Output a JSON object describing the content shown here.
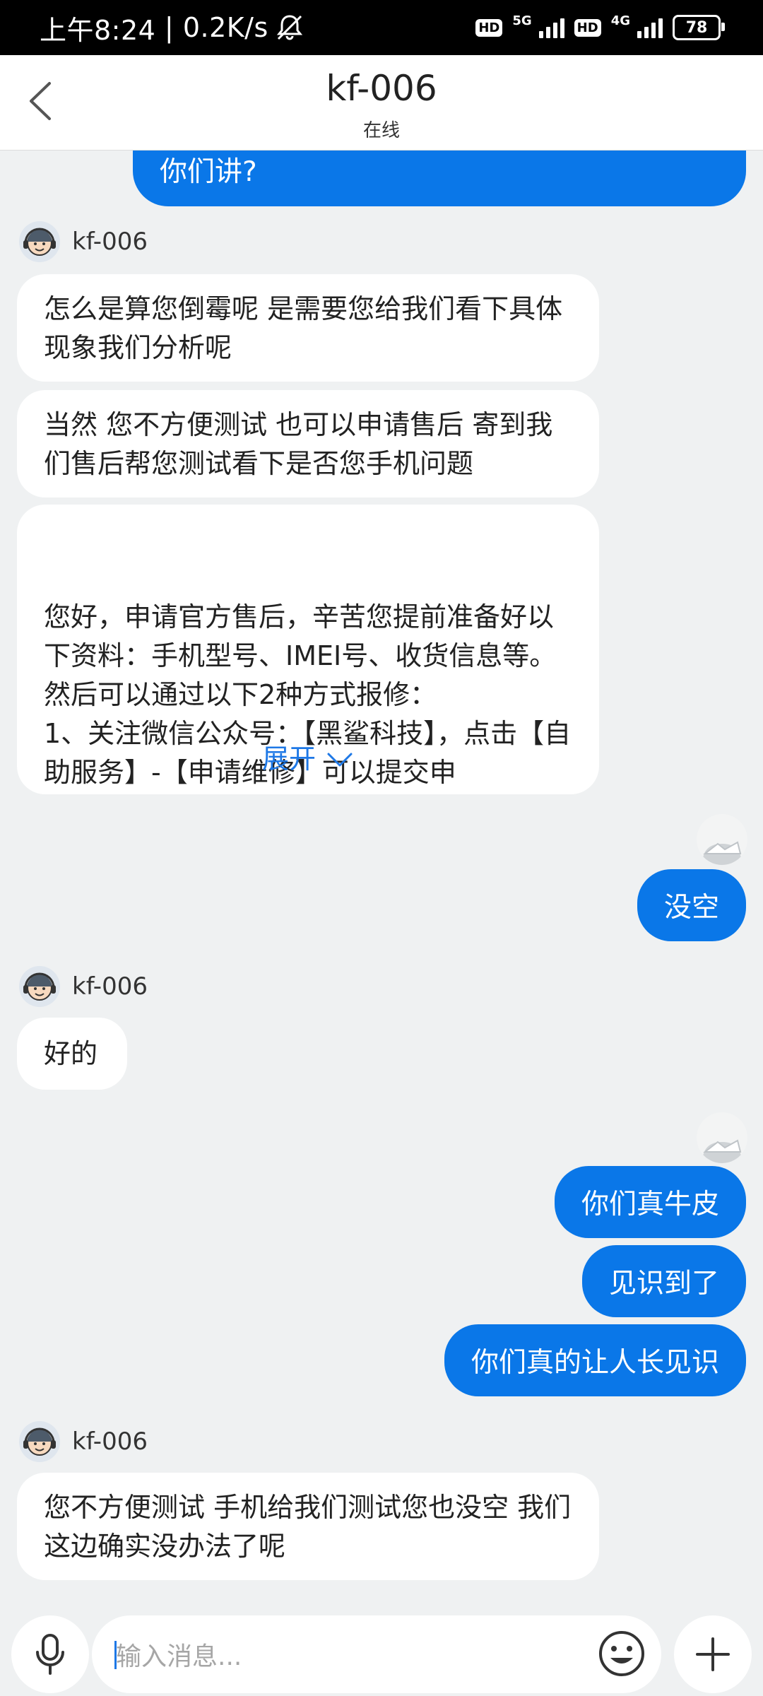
{
  "status_bar": {
    "time": "上午8:24",
    "net_speed": "0.2K/s",
    "hd1": "HD",
    "net1": "5G",
    "hd2": "HD",
    "net2": "4G",
    "battery": "78"
  },
  "header": {
    "title": "kf-006",
    "subtitle": "在线"
  },
  "messages": [
    {
      "from": "user",
      "text": "你们讲?"
    },
    {
      "from": "agent",
      "name": "kf-006",
      "text": "怎么是算您倒霉呢 是需要您给我们看下具体现象我们分析呢"
    },
    {
      "from": "agent",
      "text": "当然 您不方便测试 也可以申请售后 寄到我们售后帮您测试看下是否您手机问题"
    },
    {
      "from": "agent",
      "text": "您好，申请官方售后，辛苦您提前准备好以下资料：手机型号、IMEI号、收货信息等。然后可以通过以下2种方式报修：\n1、关注微信公众号：【黑鲨科技】，点击【自助服务】-【申请维修】可以提交申",
      "expand_label": "展开"
    },
    {
      "from": "user",
      "text": "没空"
    },
    {
      "from": "agent",
      "name": "kf-006",
      "text": "好的"
    },
    {
      "from": "user",
      "text": "你们真牛皮"
    },
    {
      "from": "user",
      "text": "见识到了"
    },
    {
      "from": "user",
      "text": "你们真的让人长见识"
    },
    {
      "from": "agent",
      "name": "kf-006",
      "text": "您不方便测试 手机给我们测试您也没空 我们这边确实没办法了呢"
    }
  ],
  "input": {
    "placeholder": "输入消息..."
  },
  "colors": {
    "user_bubble": "#0a77e8",
    "link": "#1e78e6",
    "background": "#eff1f2"
  },
  "icons": [
    "back-arrow-icon",
    "mic-icon",
    "emoji-icon",
    "plus-icon",
    "mute-bell-icon"
  ]
}
